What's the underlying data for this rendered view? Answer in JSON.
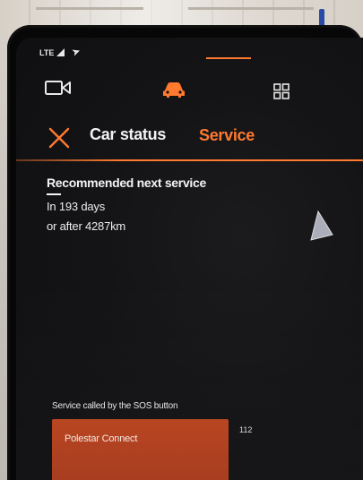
{
  "status_bar": {
    "network": "LTE"
  },
  "header": {
    "title": "Car status",
    "active_tab": "Service"
  },
  "service": {
    "heading": "Recommended next service",
    "days": "In 193 days",
    "distance": "or after 4287km"
  },
  "bottom": {
    "sos_label": "Service called by the SOS button",
    "connect_button": "Polestar Connect",
    "call_number": "112"
  },
  "icons": {
    "camera": "camera-icon",
    "car": "car-icon",
    "apps": "grid-icon",
    "close": "close-icon",
    "location": "location-arrow-icon",
    "pointer": "mouse-pointer-icon"
  },
  "colors": {
    "accent": "#ff7a2f",
    "button": "#b0401e",
    "background": "#131315",
    "text": "#f2f2f2"
  }
}
